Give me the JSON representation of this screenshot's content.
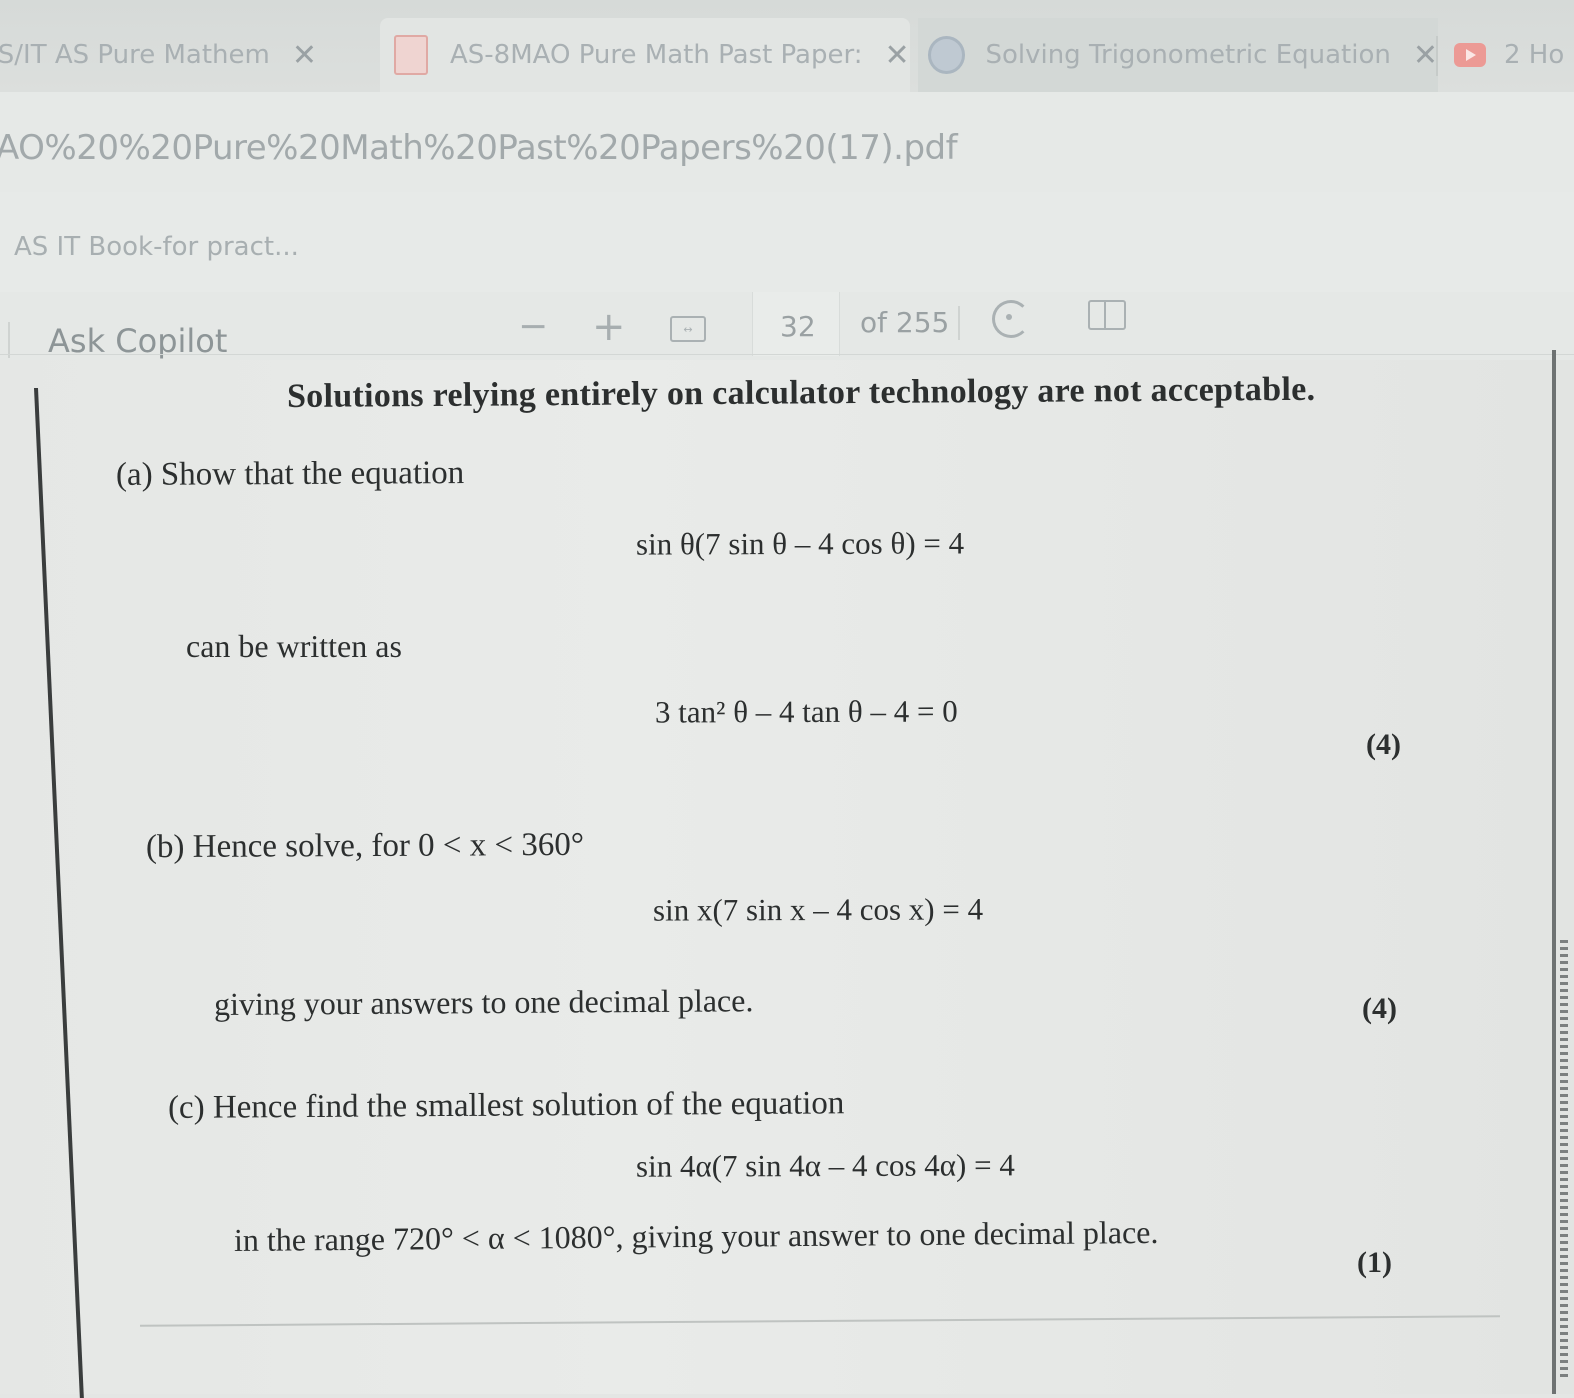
{
  "tabs": [
    {
      "label": "AS/IT AS Pure Mathem",
      "close": "✕"
    },
    {
      "label": "AS-8MAO Pure Math Past Paper:",
      "close": "✕"
    },
    {
      "label": "Solving Trigonometric Equation",
      "close": "✕"
    },
    {
      "label": "2 Ho"
    }
  ],
  "address": {
    "url": "AO%20%20Pure%20Math%20Past%20Papers%20(17).pdf"
  },
  "bookmarks": [
    {
      "label": "AS IT Book-for pract..."
    }
  ],
  "pdf_toolbar": {
    "copilot": "Ask Copilot",
    "zoom_out": "−",
    "zoom_in": "+",
    "page": "32",
    "total": "of 255"
  },
  "document": {
    "notice": "Solutions relying entirely on calculator technology are not acceptable.",
    "part_a": {
      "intro": "(a) Show that the equation",
      "eq1": "sin θ(7 sin θ – 4 cos θ) = 4",
      "middle": "can be written as",
      "eq2": "3 tan² θ – 4 tan θ – 4 = 0",
      "marks": "(4)"
    },
    "part_b": {
      "intro": "(b) Hence solve, for 0 < x < 360°",
      "eq": "sin x(7 sin x – 4 cos x) = 4",
      "instruction": "giving your answers to one decimal place.",
      "marks": "(4)"
    },
    "part_c": {
      "intro": "(c) Hence find the smallest solution of the equation",
      "eq": "sin 4α(7 sin 4α – 4 cos 4α) = 4",
      "instruction": "in the range 720° < α < 1080°, giving your answer to one decimal place.",
      "marks": "(1)"
    }
  }
}
